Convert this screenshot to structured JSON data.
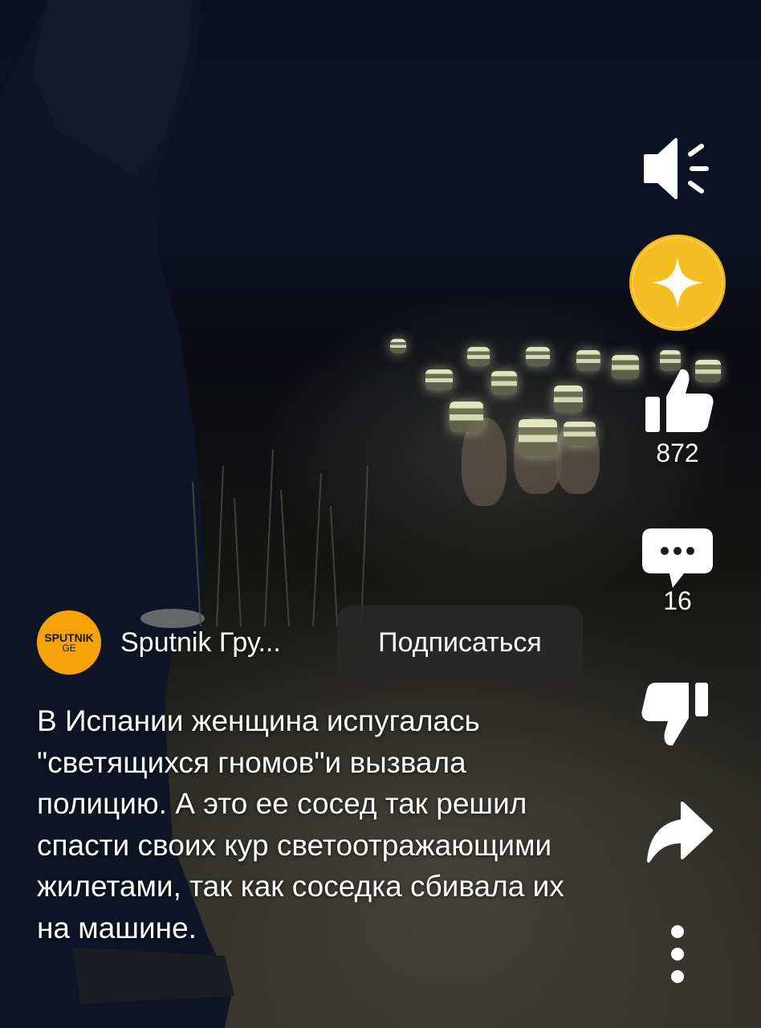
{
  "video": {
    "description": "В Испании женщина испугалась \"светящихся гномов\"и вызвала полицию. А это ее сосед так решил спасти своих кур светоотражающими жилетами, так как соседка сбивала их на машине."
  },
  "channel": {
    "avatar_line1": "SPUTNIK",
    "avatar_line2": "GE",
    "name": "Sputnik Гру...",
    "subscribe_label": "Подписаться",
    "avatar_color": "#f5a20b"
  },
  "actions": {
    "sound_icon": "speaker-icon",
    "ai_icon": "sparkle-icon",
    "likes_count": "872",
    "comments_count": "16",
    "dislike_icon": "thumbs-down-icon",
    "share_icon": "share-arrow-icon",
    "more_icon": "vertical-dots-icon",
    "accent_color": "#f4b81a"
  }
}
